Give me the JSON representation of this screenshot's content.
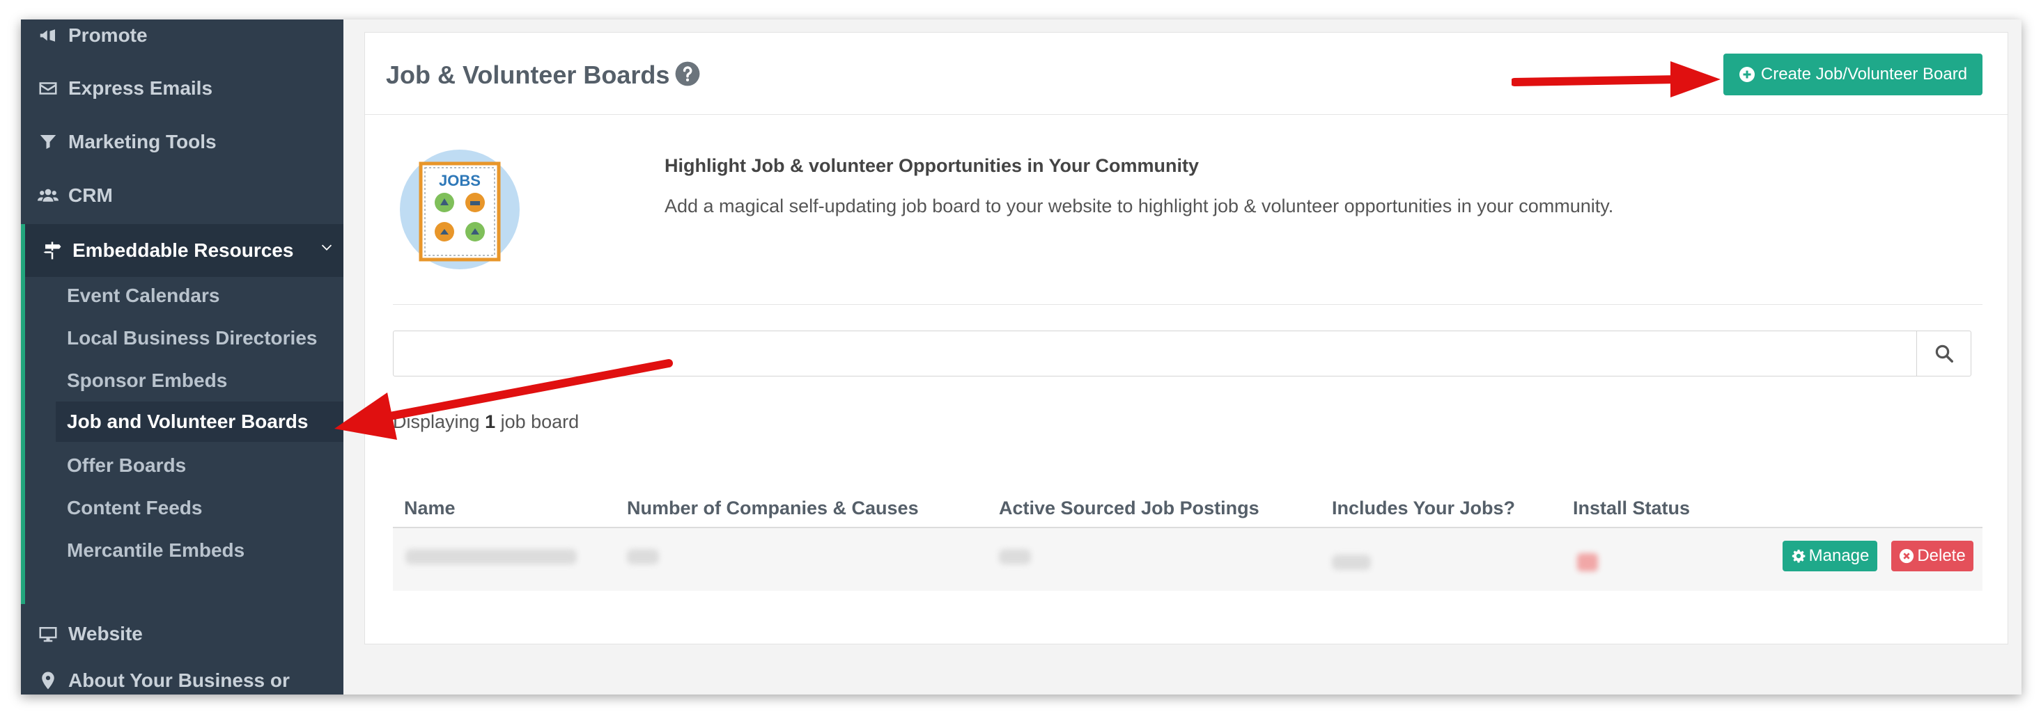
{
  "sidebar": {
    "items": [
      {
        "label": "Promote",
        "icon": "megaphone-icon"
      },
      {
        "label": "Express Emails",
        "icon": "envelope-icon"
      },
      {
        "label": "Marketing Tools",
        "icon": "filter-icon"
      },
      {
        "label": "CRM",
        "icon": "users-icon"
      },
      {
        "label": "Embeddable Resources",
        "icon": "signpost-icon"
      },
      {
        "label": "Website",
        "icon": "desktop-icon"
      },
      {
        "label": "About Your Business or Organization",
        "icon": "map-marker-icon"
      }
    ],
    "sub_items": [
      {
        "label": "Event Calendars"
      },
      {
        "label": "Local Business Directories"
      },
      {
        "label": "Sponsor Embeds"
      },
      {
        "label": "Job and Volunteer Boards"
      },
      {
        "label": "Offer Boards"
      },
      {
        "label": "Content Feeds"
      },
      {
        "label": "Mercantile Embeds"
      }
    ]
  },
  "header": {
    "title": "Job & Volunteer Boards",
    "create_button": "Create Job/Volunteer Board"
  },
  "intro": {
    "image_text": "JOBS",
    "heading": "Highlight Job & volunteer Opportunities in Your Community",
    "text": "Add a magical self-updating job board to your website to highlight job & volunteer opportunities in your community."
  },
  "search": {
    "value": "",
    "placeholder": ""
  },
  "results": {
    "prefix": "Displaying ",
    "count": "1",
    "suffix": " job board"
  },
  "table": {
    "columns": [
      "Name",
      "Number of Companies & Causes",
      "Active Sourced Job Postings",
      "Includes Your Jobs?",
      "Install Status"
    ],
    "row_actions": {
      "manage": "Manage",
      "delete": "Delete"
    }
  },
  "colors": {
    "sidebar_bg": "#2f3d4c",
    "accent_green": "#1fa98a",
    "delete_red": "#e4505a",
    "annotation_red": "#e01010"
  }
}
